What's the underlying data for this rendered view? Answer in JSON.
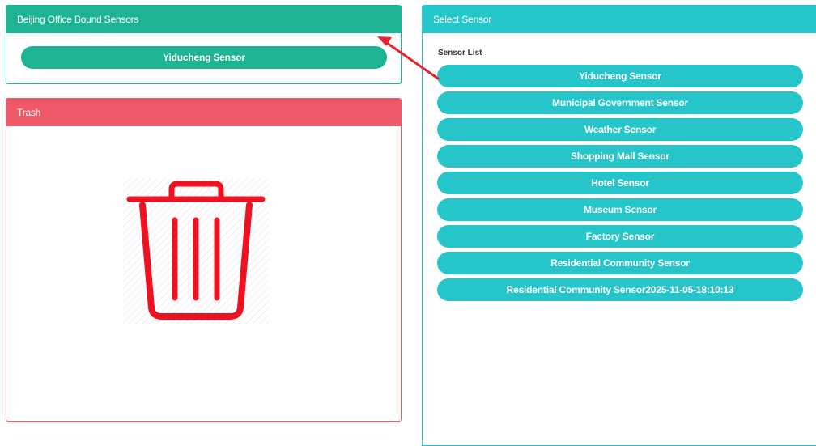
{
  "bound_panel": {
    "title": "Beijing Office Bound Sensors",
    "items": [
      {
        "label": "Yiducheng Sensor"
      }
    ]
  },
  "trash_panel": {
    "title": "Trash",
    "icon": "trash-icon"
  },
  "select_panel": {
    "title": "Select Sensor",
    "list_label": "Sensor List",
    "items": [
      {
        "label": "Yiducheng Sensor"
      },
      {
        "label": "Municipal Government Sensor"
      },
      {
        "label": "Weather Sensor"
      },
      {
        "label": "Shopping Mall Sensor"
      },
      {
        "label": "Hotel Sensor"
      },
      {
        "label": "Museum Sensor"
      },
      {
        "label": "Factory Sensor"
      },
      {
        "label": "Residential Community Sensor"
      },
      {
        "label": "Residential Community Sensor2025-11-05-18:10:13"
      }
    ]
  },
  "colors": {
    "bound_accent": "#1db393",
    "trash_accent": "#ef5866",
    "select_accent": "#25c5c9",
    "trash_icon": "#ee1122",
    "arrow": "#e8232e"
  }
}
